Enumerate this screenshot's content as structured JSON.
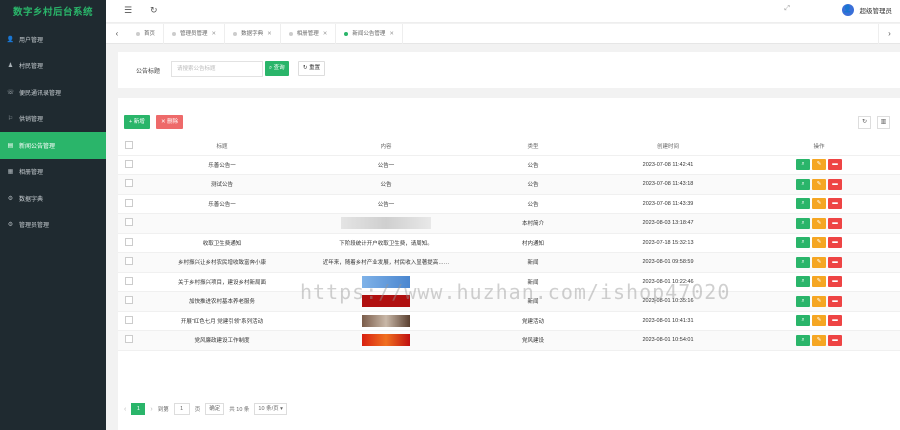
{
  "app": {
    "title": "数字乡村后台系统"
  },
  "colors": {
    "accent": "#2ab56a",
    "sidebar_bg": "#1f2a30",
    "danger": "#ee4444",
    "warning": "#f5a623"
  },
  "sidebar": {
    "items": [
      {
        "label": "用户管理",
        "icon": "user-icon"
      },
      {
        "label": "村民管理",
        "icon": "person-icon"
      },
      {
        "label": "便民通讯录管理",
        "icon": "contact-icon"
      },
      {
        "label": "供销管理",
        "icon": "cart-icon"
      },
      {
        "label": "新闻公告管理",
        "icon": "news-icon",
        "active": true
      },
      {
        "label": "相册管理",
        "icon": "album-icon"
      },
      {
        "label": "数据字典",
        "icon": "gear-icon"
      },
      {
        "label": "管理员管理",
        "icon": "gear-icon"
      }
    ]
  },
  "header": {
    "user": "超级管理员"
  },
  "tabs": [
    {
      "label": "首页"
    },
    {
      "label": "管理员管理"
    },
    {
      "label": "数据字典"
    },
    {
      "label": "相册管理"
    },
    {
      "label": "新闻公告管理",
      "active": true
    }
  ],
  "search": {
    "label": "公告标题",
    "placeholder": "请搜索公告标题",
    "search_button": "查询",
    "reset_button": "重置"
  },
  "toolbar": {
    "add_label": "+ 新增",
    "delete_label": "删除"
  },
  "table": {
    "columns": [
      "标题",
      "内容",
      "类型",
      "创建时间",
      "操作"
    ],
    "rows": [
      {
        "title": "乐善公告一",
        "content": "公告一",
        "type": "公告",
        "created": "2023-07-08 11:42:41",
        "image": ""
      },
      {
        "title": "测试公告",
        "content": "公告",
        "type": "公告",
        "created": "2023-07-08 11:43:18",
        "image": ""
      },
      {
        "title": "乐善公告一",
        "content": "公告一",
        "type": "公告",
        "created": "2023-07-08 11:43:39",
        "image": ""
      },
      {
        "title": "",
        "content": "",
        "type": "本村简介",
        "created": "2023-08-03 13:18:47",
        "image": "blur"
      },
      {
        "title": "收取卫生费通知",
        "content": "下阶段统计开户收取卫生费，请周知。",
        "type": "村内通知",
        "created": "2023-07-18 15:32:13",
        "image": ""
      },
      {
        "title": "乡村振兴让乡村农民增收致富奔小康",
        "content": "近年来，随着乡村产业发展，村民收入显著提高……",
        "type": "新闻",
        "created": "2023-08-01 09:58:59",
        "image": ""
      },
      {
        "title": "关于乡村振兴项目，建设乡村新局面",
        "content": "",
        "type": "新闻",
        "created": "2023-08-01 10:22:46",
        "image": "blue"
      },
      {
        "title": "加快推进农村基本养老服务",
        "content": "",
        "type": "新闻",
        "created": "2023-08-01 10:35:16",
        "image": "red"
      },
      {
        "title": "开展“红色七月 党建引领”系列活动",
        "content": "",
        "type": "党建活动",
        "created": "2023-08-01 10:41:31",
        "image": "photo"
      },
      {
        "title": "党风廉政建设工作制度",
        "content": "",
        "type": "党风建设",
        "created": "2023-08-01 10:54:01",
        "image": "fire"
      }
    ]
  },
  "pager": {
    "current": "1",
    "goto_label": "到第",
    "goto_value": "1",
    "page_unit": "页",
    "confirm_label": "确定",
    "total": "共 10 条",
    "page_size": "10 条/页"
  },
  "watermark": "https://www.huzhan.com/ishop47020"
}
